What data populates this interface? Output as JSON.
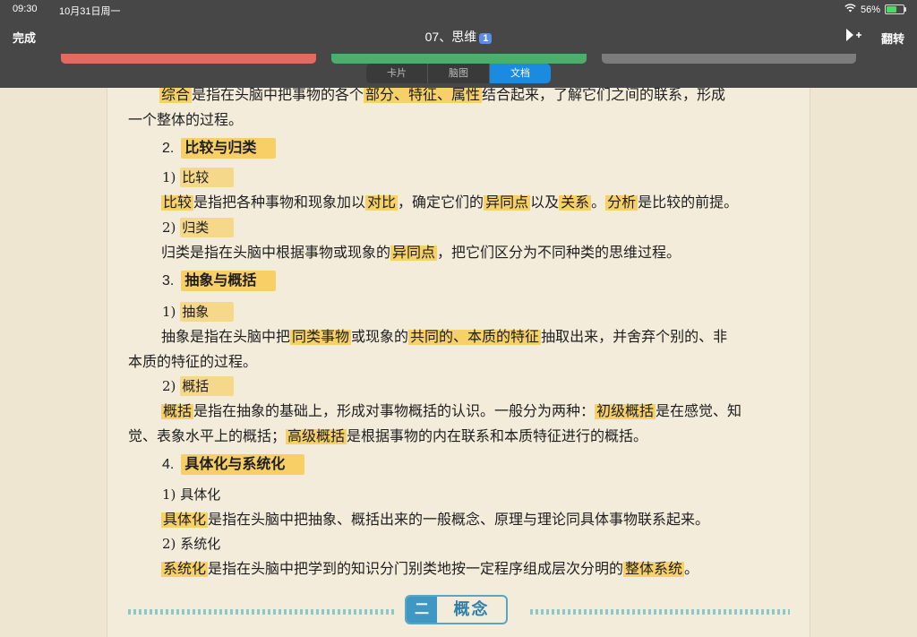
{
  "status": {
    "time": "09:30",
    "date": "10月31日周一",
    "battery": "56%",
    "battery_level": 0.56
  },
  "nav": {
    "done": "完成",
    "title": "07、思维",
    "title_badge": "1",
    "flip": "翻转"
  },
  "segments": [
    "卡片",
    "脑图",
    "文档"
  ],
  "active_segment": "文档",
  "colors": {
    "accent": "#1a8be0",
    "highlight": "#f7c848",
    "red": "#e46a61",
    "green": "#4cae6c"
  },
  "doc": {
    "l1": {
      "hl": "综合",
      "rest": "是指在头脑中把事物的各个",
      "hl2": "部分、特征、属性",
      "rest2": "结合起来，了解它们之间的联系，形成"
    },
    "l2": "一个整体的过程。",
    "h_compare": {
      "num": "2.",
      "text": "比较与归类"
    },
    "s_compare": {
      "num": "1)",
      "text": "比较"
    },
    "compare_line": {
      "a": "比较",
      "b": "是指把各种事物和现象加以",
      "c": "对比",
      "d": "，确定它们的",
      "e": "异同点",
      "f": "以及",
      "g": "关系",
      "h": "。",
      "i": "分析",
      "j": "是比较的前提。"
    },
    "s_classify": {
      "num": "2)",
      "text": "归类"
    },
    "classify_line": {
      "a": "归类是指在头脑中根据事物或现象的",
      "b": "异同点",
      "c": "，把它们区分为不同种类的思维过程。"
    },
    "h_abstract": {
      "num": "3.",
      "text": "抽象与概括"
    },
    "s_abstract": {
      "num": "1)",
      "text": "抽象"
    },
    "abstract_line1": {
      "a": "抽象是指在头脑中把",
      "b": "同类事物",
      "c": "或现象的",
      "d": "共同的、本质的特征",
      "e": "抽取出来，并舍弃个别的、非"
    },
    "abstract_line2": "本质的特征的过程。",
    "s_general": {
      "num": "2)",
      "text": "概括"
    },
    "general_line1": {
      "a": "概括",
      "b": "是指在抽象的基础上，形成对事物概括的认识。一般分为两种：",
      "c": "初级概括",
      "d": "是在感觉、知"
    },
    "general_line2": {
      "a": "觉、表象水平上的概括；",
      "b": "高级概括",
      "c": "是根据事物的内在联系和本质特征进行的概括。"
    },
    "h_concrete": {
      "num": "4.",
      "text": "具体化与系统化"
    },
    "s_concrete": {
      "num": "1)",
      "text": "具体化"
    },
    "concrete_line": {
      "a": "具体化",
      "b": "是指在头脑中把抽象、概括出来的一般概念、原理与理论同具体事物联系起来。"
    },
    "s_system": {
      "num": "2)",
      "text": "系统化"
    },
    "system_line": {
      "a": "系统化",
      "b": "是指在头脑中把学到的知识分门别类地按一定程序组成层次分明的",
      "c": "整体系统",
      "d": "。"
    },
    "section": {
      "num": "二",
      "text": "概念"
    }
  }
}
